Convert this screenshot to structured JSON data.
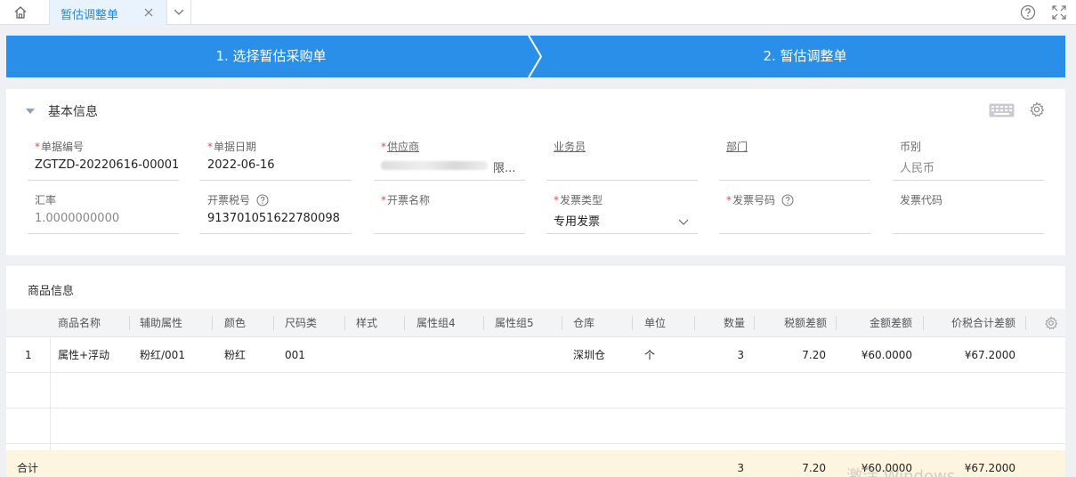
{
  "tabbar": {
    "active_tab": "暂估调整单"
  },
  "steps": [
    {
      "label": "1. 选择暂估采购单"
    },
    {
      "label": "2. 暂估调整单"
    }
  ],
  "basic": {
    "title": "基本信息",
    "fields": {
      "bill_no": {
        "label": "单据编号",
        "value": "ZGTZD-20220616-00001"
      },
      "bill_date": {
        "label": "单据日期",
        "value": "2022-06-16"
      },
      "supplier": {
        "label": "供应商",
        "value_tail": "限..."
      },
      "salesman": {
        "label": "业务员",
        "value": ""
      },
      "department": {
        "label": "部门",
        "value": ""
      },
      "currency": {
        "label": "币别",
        "value": "人民币"
      },
      "exchange_rate": {
        "label": "汇率",
        "value": "1.0000000000"
      },
      "tax_no": {
        "label": "开票税号",
        "value": "913701051622780098"
      },
      "invoice_name": {
        "label": "开票名称",
        "value": ""
      },
      "invoice_type": {
        "label": "发票类型",
        "value": "专用发票"
      },
      "invoice_no": {
        "label": "发票号码",
        "value": ""
      },
      "invoice_code": {
        "label": "发票代码",
        "value": ""
      }
    }
  },
  "goods": {
    "title": "商品信息",
    "columns": [
      "商品名称",
      "辅助属性",
      "颜色",
      "尺码类",
      "样式",
      "属性组4",
      "属性组5",
      "仓库",
      "单位",
      "数量",
      "税额差额",
      "金额差额",
      "价税合计差额"
    ],
    "rows": [
      {
        "no": "1",
        "name": "属性+浮动",
        "aux": "粉红/001",
        "color": "粉红",
        "size": "001",
        "style": "",
        "g4": "",
        "g5": "",
        "warehouse": "深圳仓",
        "unit": "个",
        "qty": "3",
        "tax_diff": "7.20",
        "amount_diff": "¥60.0000",
        "total_diff": "¥67.2000"
      }
    ],
    "totals": {
      "label": "合计",
      "qty": "3",
      "tax_diff": "7.20",
      "amount_diff": "¥60.0000",
      "total_diff": "¥67.2000"
    }
  },
  "watermark": "激活 Windows",
  "colors": {
    "accent": "#2a8fe8",
    "required": "#e34d4d",
    "total_bg": "#fdf5df"
  }
}
